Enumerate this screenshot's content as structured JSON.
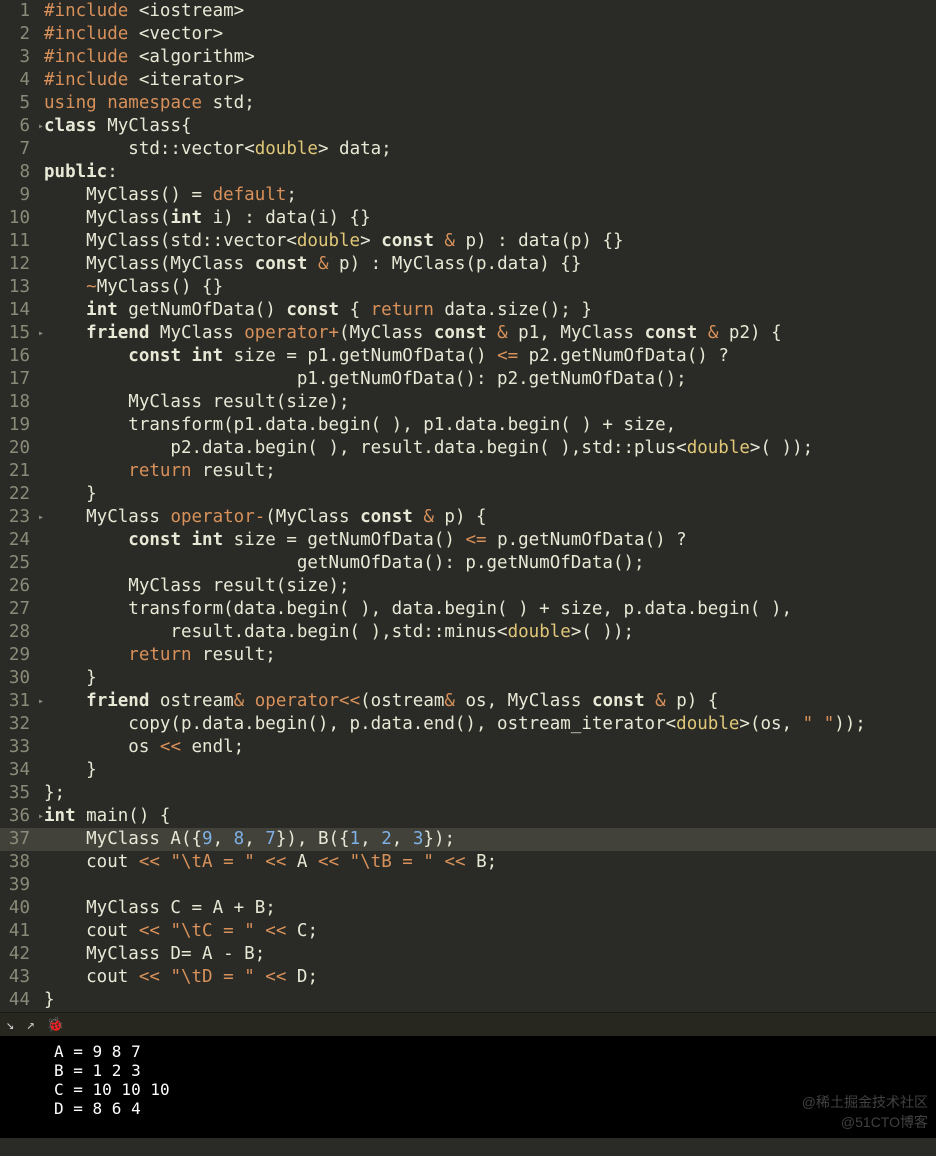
{
  "code_lines": [
    {
      "n": 1,
      "fold": "",
      "html": "<span class='k-pp'>#include</span> <span class='ang'>&lt;iostream&gt;</span>"
    },
    {
      "n": 2,
      "fold": "",
      "html": "<span class='k-pp'>#include</span> <span class='ang'>&lt;vector&gt;</span>"
    },
    {
      "n": 3,
      "fold": "",
      "html": "<span class='k-pp'>#include</span> <span class='ang'>&lt;algorithm&gt;</span>"
    },
    {
      "n": 4,
      "fold": "",
      "html": "<span class='k-pp'>#include</span> <span class='ang'>&lt;iterator&gt;</span>"
    },
    {
      "n": 5,
      "fold": "",
      "html": "<span class='k-pp'>using</span> <span class='k-pp'>namespace</span> std;"
    },
    {
      "n": 6,
      "fold": "▸",
      "html": "<span class='bluekw'>class</span> MyClass{"
    },
    {
      "n": 7,
      "fold": "",
      "html": "        std::vector<span class='ang'>&lt;</span><span class='tparam'>double</span><span class='ang'>&gt;</span> data;"
    },
    {
      "n": 8,
      "fold": "",
      "html": "<span class='bluekw'>public</span>:"
    },
    {
      "n": 9,
      "fold": "",
      "html": "    MyClass() = <span class='k-pp'>default</span>;"
    },
    {
      "n": 10,
      "fold": "",
      "html": "    MyClass(<span class='bluekw'>int</span> i) : data(i) {}"
    },
    {
      "n": 11,
      "fold": "",
      "html": "    MyClass(std::vector<span class='ang'>&lt;</span><span class='tparam'>double</span><span class='ang'>&gt;</span> <span class='bluekw'>const</span> <span class='amp'>&amp;</span> p) : data(p) {}"
    },
    {
      "n": 12,
      "fold": "",
      "html": "    MyClass(MyClass <span class='bluekw'>const</span> <span class='amp'>&amp;</span> p) : MyClass(p.data) {}"
    },
    {
      "n": 13,
      "fold": "",
      "html": "    <span class='amp'>~</span>MyClass() {}"
    },
    {
      "n": 14,
      "fold": "",
      "html": "    <span class='bluekw'>int</span> getNumOfData() <span class='bluekw'>const</span> { <span class='k-pp'>return</span> data.size(); }"
    },
    {
      "n": 15,
      "fold": "▸",
      "html": "    <span class='bluekw'>friend</span> MyClass <span class='k-pp'>operator+</span>(MyClass <span class='bluekw'>const</span> <span class='amp'>&amp;</span> p1, MyClass <span class='bluekw'>const</span> <span class='amp'>&amp;</span> p2) {"
    },
    {
      "n": 16,
      "fold": "",
      "html": "        <span class='bluekw'>const int</span> size = p1.getNumOfData() <span class='amp'>&lt;=</span> p2.getNumOfData() ?"
    },
    {
      "n": 17,
      "fold": "",
      "html": "                        p1.getNumOfData(): p2.getNumOfData();"
    },
    {
      "n": 18,
      "fold": "",
      "html": "        MyClass result(size);"
    },
    {
      "n": 19,
      "fold": "",
      "html": "        transform(p1.data.begin( ), p1.data.begin( ) + size,"
    },
    {
      "n": 20,
      "fold": "",
      "html": "            p2.data.begin( ), result.data.begin( ),std::plus<span class='ang'>&lt;</span><span class='tparam'>double</span><span class='ang'>&gt;</span>( ));"
    },
    {
      "n": 21,
      "fold": "",
      "html": "        <span class='k-pp'>return</span> result;"
    },
    {
      "n": 22,
      "fold": "",
      "html": "    }"
    },
    {
      "n": 23,
      "fold": "▸",
      "html": "    MyClass <span class='k-pp'>operator-</span>(MyClass <span class='bluekw'>const</span> <span class='amp'>&amp;</span> p) {"
    },
    {
      "n": 24,
      "fold": "",
      "html": "        <span class='bluekw'>const int</span> size = getNumOfData() <span class='amp'>&lt;=</span> p.getNumOfData() ?"
    },
    {
      "n": 25,
      "fold": "",
      "html": "                        getNumOfData(): p.getNumOfData();"
    },
    {
      "n": 26,
      "fold": "",
      "html": "        MyClass result(size);"
    },
    {
      "n": 27,
      "fold": "",
      "html": "        transform(data.begin( ), data.begin( ) + size, p.data.begin( ),"
    },
    {
      "n": 28,
      "fold": "",
      "html": "            result.data.begin( ),std::minus<span class='ang'>&lt;</span><span class='tparam'>double</span><span class='ang'>&gt;</span>( ));"
    },
    {
      "n": 29,
      "fold": "",
      "html": "        <span class='k-pp'>return</span> result;"
    },
    {
      "n": 30,
      "fold": "",
      "html": "    }"
    },
    {
      "n": 31,
      "fold": "▸",
      "html": "    <span class='bluekw'>friend</span> ostream<span class='amp'>&amp;</span> <span class='k-pp'>operator&lt;&lt;</span>(ostream<span class='amp'>&amp;</span> os, MyClass <span class='bluekw'>const</span> <span class='amp'>&amp;</span> p) {"
    },
    {
      "n": 32,
      "fold": "",
      "html": "        copy(p.data.begin(), p.data.end(), ostream_iterator<span class='ang'>&lt;</span><span class='tparam'>double</span><span class='ang'>&gt;</span>(os, <span class='str'>\" \"</span>));"
    },
    {
      "n": 33,
      "fold": "",
      "html": "        os <span class='amp'>&lt;&lt;</span> endl;"
    },
    {
      "n": 34,
      "fold": "",
      "html": "    }"
    },
    {
      "n": 35,
      "fold": "",
      "html": "};"
    },
    {
      "n": 36,
      "fold": "▸",
      "html": "<span class='bluekw'>int</span> main() {"
    },
    {
      "n": 37,
      "fold": "",
      "hl": true,
      "html": "    MyClass A({<span class='num'>9</span>, <span class='num'>8</span>, <span class='num'>7</span>}), B({<span class='num'>1</span>, <span class='num'>2</span>, <span class='num'>3</span>});"
    },
    {
      "n": 38,
      "fold": "",
      "html": "    cout <span class='amp'>&lt;&lt;</span> <span class='str'>\"\\tA = \"</span> <span class='amp'>&lt;&lt;</span> A <span class='amp'>&lt;&lt;</span> <span class='str'>\"\\tB = \"</span> <span class='amp'>&lt;&lt;</span> B;"
    },
    {
      "n": 39,
      "fold": "",
      "html": ""
    },
    {
      "n": 40,
      "fold": "",
      "html": "    MyClass C = A + B;"
    },
    {
      "n": 41,
      "fold": "",
      "html": "    cout <span class='amp'>&lt;&lt;</span> <span class='str'>\"\\tC = \"</span> <span class='amp'>&lt;&lt;</span> C;"
    },
    {
      "n": 42,
      "fold": "",
      "html": "    MyClass D= A - B;"
    },
    {
      "n": 43,
      "fold": "",
      "html": "    cout <span class='amp'>&lt;&lt;</span> <span class='str'>\"\\tD = \"</span> <span class='amp'>&lt;&lt;</span> D;"
    },
    {
      "n": 44,
      "fold": "",
      "html": "}"
    }
  ],
  "console_lines": [
    "A = 9 8 7 ",
    "B = 1 2 3 ",
    "C = 10 10 10 ",
    "D = 8 6 4 "
  ],
  "toolbar_icons": {
    "collapse": "↘",
    "expand": "↗",
    "bug": "🐞"
  },
  "watermark": {
    "line1": "@稀土掘金技术社区",
    "line2": "@51CTO博客"
  }
}
